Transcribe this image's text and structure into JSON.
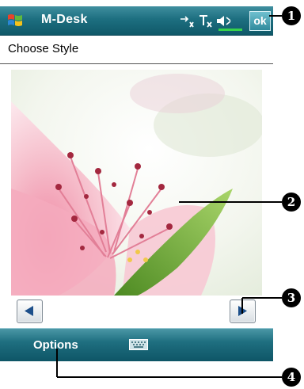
{
  "titlebar": {
    "app_title": "M-Desk",
    "ok_label": "ok",
    "icons": [
      "windows-start-icon",
      "connectivity-icon",
      "signal-off-icon",
      "volume-icon"
    ]
  },
  "header": {
    "title": "Choose Style"
  },
  "preview": {
    "image": "pink-flower-wallpaper"
  },
  "navigation": {
    "prev_icon": "left-arrow-icon",
    "next_icon": "right-arrow-icon"
  },
  "softbar": {
    "options_label": "Options",
    "keyboard_icon": "keyboard-icon"
  },
  "callouts": [
    "1",
    "2",
    "3",
    "4"
  ],
  "colors": {
    "bar": "#1d6f80",
    "bar_light": "#4b97a6",
    "flower_pink": "#f2a6b8",
    "leaf_green": "#6fa83a"
  }
}
